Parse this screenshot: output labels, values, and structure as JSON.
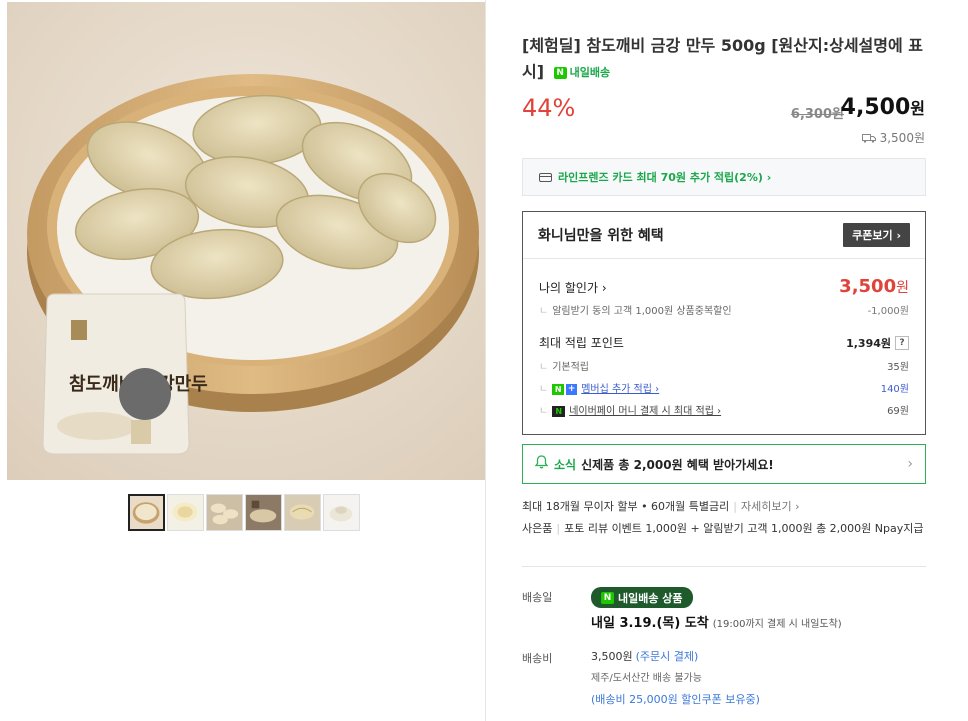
{
  "product": {
    "title": "[체험딜] 참도깨비 금강 만두 500g [원산지:상세설명에 표시]",
    "tomorrow_badge": "내일배송",
    "discount_pct": "44%",
    "original_price": "6,300원",
    "final_price": "4,500",
    "final_price_unit": "원",
    "shipping_fee_short": "3,500원",
    "package_text": "참도깨비 금강만두"
  },
  "card_promo": "라인프렌즈 카드 최대 70원 추가 적립(2%) ›",
  "benefit": {
    "title": "화니님만을 위한 혜택",
    "coupon_button": "쿠폰보기 ›",
    "my_price_label": "나의 할인가 ›",
    "my_price_value": "3,500",
    "my_price_unit": "원",
    "alarm_discount_label": "알림받기 동의 고객 1,000원 상품중복할인",
    "alarm_discount_value": "-1,000원",
    "max_points_label": "최대 적립 포인트",
    "max_points_value": "1,394원",
    "help_mark": "?",
    "base_points_label": "기본적립",
    "base_points_value": "35원",
    "membership_label": "멤버십 추가 적립 ›",
    "membership_value": "140원",
    "npay_label": "네이버페이 머니 결제 시 최대 적립 ›",
    "npay_value": "69원"
  },
  "news": {
    "tag": "소식",
    "message": "신제품 총 2,000원 혜택 받아가세요!",
    "arrow": "›"
  },
  "installment": {
    "text": "최대 18개월 무이자 할부 • 60개월 특별금리",
    "more": "자세히보기 ›"
  },
  "gift": {
    "label": "사은품",
    "text": "포토 리뷰 이벤트 1,000원 + 알림받기 고객 1,000원 총 2,000원 Npay지급"
  },
  "delivery": {
    "label": "배송일",
    "pill": "내일배송 상품",
    "arrive_text": "내일 3.19.(목) 도착",
    "arrive_note": "(19:00까지 결제 시 내일도착)",
    "fee_label": "배송비",
    "fee_value": "3,500원",
    "fee_link": "(주문시 결제)",
    "fee_note": "제주/도서산간 배송 불가능",
    "fee_coupon": "(배송비 25,000원 할인쿠폰 보유중)"
  },
  "colors": {
    "accent_red": "#e0433a",
    "accent_green": "#1aa84b",
    "link_blue": "#3b78d8"
  },
  "icons": [
    "card-icon",
    "truck-icon",
    "bell-icon",
    "naver-n-icon",
    "npay-icon",
    "chevron-right-icon"
  ]
}
